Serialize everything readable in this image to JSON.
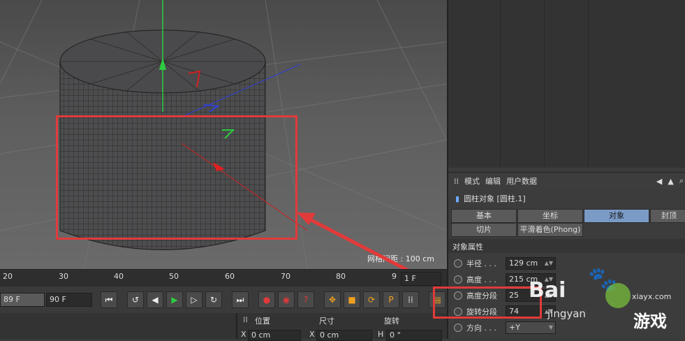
{
  "viewport": {
    "grid_spacing_label": "网格间距 : 100 cm"
  },
  "timeline": {
    "ticks": [
      "20",
      "30",
      "40",
      "50",
      "60",
      "70",
      "80",
      "9"
    ],
    "current_frame": "1 F"
  },
  "transport": {
    "start_frame": "89 F",
    "end_frame": "90 F"
  },
  "coords": {
    "headers": [
      "位置",
      "尺寸",
      "旋转"
    ],
    "row": [
      "0 cm",
      "0 cm",
      "0 °"
    ],
    "axis_labels": [
      "X",
      "X",
      "H"
    ]
  },
  "attributes": {
    "menu": [
      "模式",
      "编辑",
      "用户数据"
    ],
    "object_title": "圆柱对象 [圆柱.1]",
    "tabs_row1": [
      "基本",
      "坐标",
      "对象",
      "封顶"
    ],
    "tabs_row2": [
      "切片",
      "平滑着色(Phong)"
    ],
    "active_tab": "对象",
    "section": "对象属性",
    "props": [
      {
        "label": "半径 . . .",
        "value": "129 cm"
      },
      {
        "label": "高度 . . .",
        "value": "215 cm"
      },
      {
        "label": "高度分段",
        "value": "25"
      },
      {
        "label": "旋转分段",
        "value": "74"
      },
      {
        "label": "方向 . . .",
        "value": "+Y"
      }
    ]
  },
  "watermarks": {
    "baidu": "Bai",
    "jingyan": "jingyan",
    "site": "xiayx.com",
    "game": "游戏"
  },
  "colors": {
    "accent_tab": "#7b9bc7",
    "highlight_red": "#e23a3a"
  }
}
